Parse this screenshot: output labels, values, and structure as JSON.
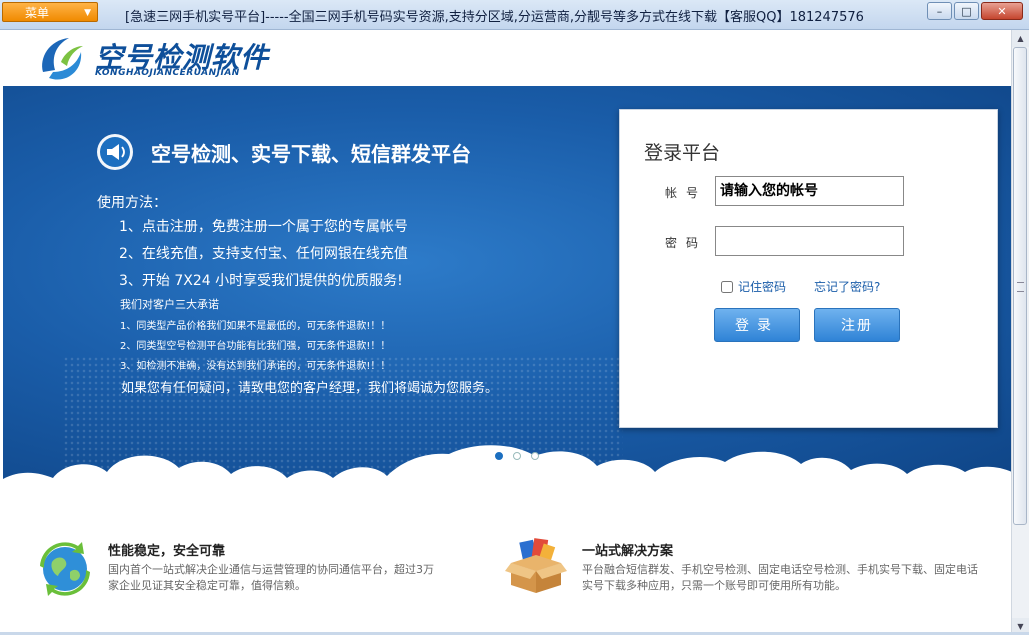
{
  "window": {
    "menu_label": "菜单",
    "title": "[急速三网手机实号平台]-----全国三网手机号码实号资源,支持分区域,分运营商,分靓号等多方式在线下载【客服QQ】181247576",
    "minimize": "–",
    "maximize": "□",
    "close": "✕"
  },
  "logo": {
    "title": "空号检测软件",
    "subtitle": "KONGHAOJIANCERUANJIAN"
  },
  "banner": {
    "title": "空号检测、实号下载、短信群发平台",
    "usage_head": "使用方法：",
    "steps": [
      "1、点击注册，免费注册一个属于您的专属帐号",
      "2、在线充值，支持支付宝、任何网银在线充值",
      "3、开始 7X24 小时享受我们提供的优质服务!"
    ],
    "promise_head": "我们对客户三大承诺",
    "promises": [
      "1、同类型产品价格我们如果不是最低的，可无条件退款!！！",
      "2、同类型空号检测平台功能有比我们强，可无条件退款!！！",
      "3、如检测不准确，没有达到我们承诺的，可无条件退款!！！"
    ],
    "contact": "如果您有任何疑问，请致电您的客户经理，我们将竭诚为您服务。"
  },
  "login": {
    "title": "登录平台",
    "account_label": "帐号",
    "account_placeholder": "请输入您的帐号",
    "password_label": "密码",
    "remember_label": "记住密码",
    "forgot_label": "忘记了密码?",
    "login_button": "登录",
    "register_button": "注册"
  },
  "features": [
    {
      "title": "性能稳定，安全可靠",
      "desc": "国内首个一站式解决企业通信与运营管理的协同通信平台，超过3万家企业见证其安全稳定可靠，值得信赖。"
    },
    {
      "title": "一站式解决方案",
      "desc": "平台融合短信群发、手机空号检测、固定电话空号检测、手机实号下载、固定电话实号下载多种应用，只需一个账号即可使用所有功能。"
    }
  ],
  "colors": {
    "banner_blue": "#1a5da9",
    "menu_orange": "#f08a00",
    "button_blue": "#2f83d6"
  }
}
